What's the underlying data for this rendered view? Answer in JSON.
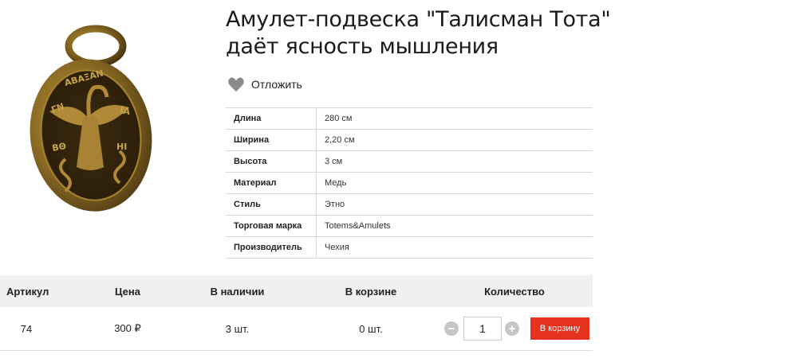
{
  "product": {
    "title_line1": "Амулет-подвеска \"Талисман Тота\"",
    "title_line2": "даёт ясность мышления",
    "wishlist_label": "Отложить"
  },
  "specs": [
    {
      "name": "Длина",
      "value": "280 см"
    },
    {
      "name": "Ширина",
      "value": "2,20 см"
    },
    {
      "name": "Высота",
      "value": "3 см"
    },
    {
      "name": "Материал",
      "value": "Медь"
    },
    {
      "name": "Стиль",
      "value": "Этно"
    },
    {
      "name": "Торговая марка",
      "value": "Totems&Amulets"
    },
    {
      "name": "Производитель",
      "value": "Чехия"
    }
  ],
  "stock": {
    "headers": {
      "article": "Артикул",
      "price": "Цена",
      "availability": "В наличии",
      "in_cart": "В корзине",
      "quantity": "Количество"
    },
    "row": {
      "article": "74",
      "price": "300 ₽",
      "availability": "3 шт.",
      "in_cart": "0 шт.",
      "quantity": "1",
      "buy_label": "В корзину"
    }
  },
  "colors": {
    "buy_button": "#e8301e",
    "header_bg": "#f0f0f0",
    "heart": "#8a8a8a"
  },
  "icons": [
    "amulet-image",
    "heart-icon",
    "minus-icon",
    "plus-icon"
  ]
}
